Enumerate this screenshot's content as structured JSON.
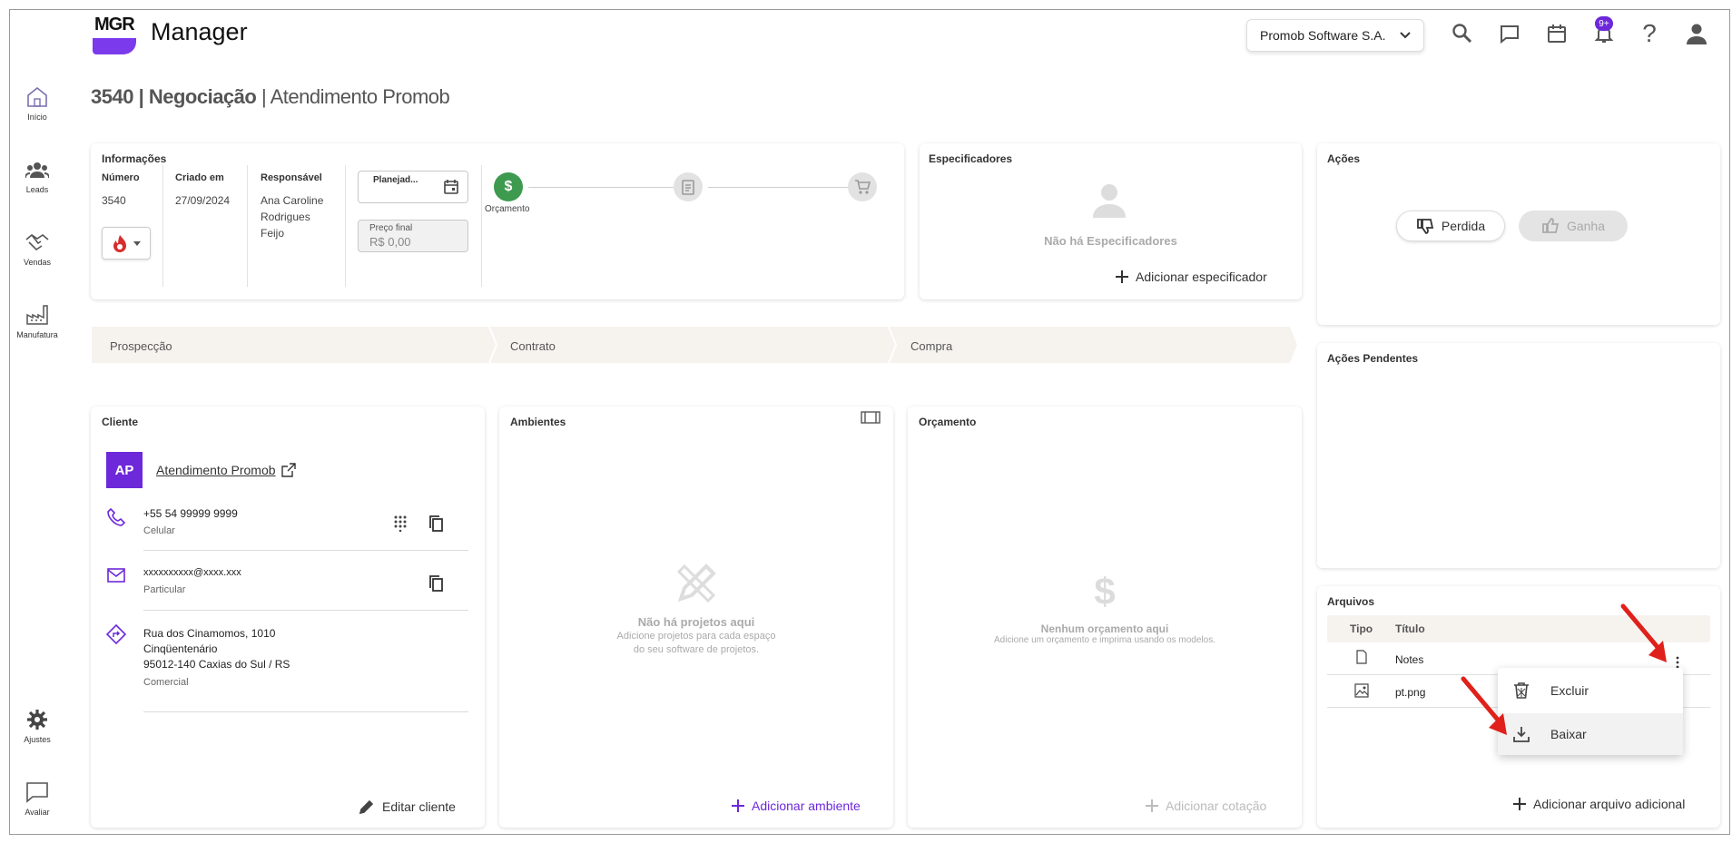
{
  "app": {
    "logo_text": "MGR",
    "title": "Manager",
    "company": "Promob Software S.A.",
    "notif_badge": "9+"
  },
  "sidebar": {
    "items": [
      {
        "label": "Início",
        "icon": "home-icon"
      },
      {
        "label": "Leads",
        "icon": "people-icon"
      },
      {
        "label": "Vendas",
        "icon": "handshake-icon"
      },
      {
        "label": "Manufatura",
        "icon": "factory-icon"
      }
    ],
    "bottom": [
      {
        "label": "Ajustes",
        "icon": "gear-icon"
      },
      {
        "label": "Avaliar",
        "icon": "chat-icon"
      }
    ]
  },
  "page": {
    "number": "3540",
    "type": "Negociação",
    "name": "Atendimento Promob"
  },
  "info": {
    "title": "Informações",
    "numero_label": "Número",
    "numero": "3540",
    "criado_label": "Criado em",
    "criado": "27/09/2024",
    "resp_label": "Responsável",
    "resp_lines": [
      "Ana Caroline",
      "Rodrigues",
      "Feijo"
    ],
    "planejado_label": "Planejad...",
    "preco_label": "Preço final",
    "preco": "R$ 0,00",
    "step1": "Orçamento"
  },
  "specs": {
    "title": "Especificadores",
    "empty": "Não há Especificadores",
    "add": "Adicionar especificador"
  },
  "actions": {
    "title": "Ações",
    "lose": "Perdida",
    "win": "Ganha"
  },
  "pending": {
    "title": "Ações Pendentes"
  },
  "pipeline": [
    "Prospecção",
    "Contrato",
    "Compra"
  ],
  "client": {
    "title": "Cliente",
    "initials": "AP",
    "name": "Atendimento Promob",
    "phone": "+55 54 99999 9999",
    "phone_type": "Celular",
    "email": "xxxxxxxxxx@xxxx.xxx",
    "email_type": "Particular",
    "addr1": "Rua dos Cinamomos, 1010",
    "addr2": "Cinqüentenário",
    "addr3": "95012-140 Caxias do Sul / RS",
    "addr_type": "Comercial",
    "edit": "Editar cliente"
  },
  "ambientes": {
    "title": "Ambientes",
    "empty": "Não há projetos aqui",
    "sub1": "Adicione projetos para cada espaço",
    "sub2": "do seu software de projetos.",
    "add": "Adicionar ambiente"
  },
  "orcamento": {
    "title": "Orçamento",
    "empty": "Nenhum orçamento aqui",
    "sub": "Adicione um orçamento e imprima usando os modelos.",
    "add": "Adicionar cotação"
  },
  "files": {
    "title": "Arquivos",
    "col_tipo": "Tipo",
    "col_titulo": "Título",
    "rows": [
      {
        "name": "Notes",
        "icon": "file-icon"
      },
      {
        "name": "pt.png",
        "icon": "image-icon"
      }
    ],
    "add": "Adicionar arquivo adicional"
  },
  "context_menu": {
    "delete": "Excluir",
    "download": "Baixar"
  },
  "colors": {
    "accent": "#6d28d9",
    "green": "#3d9a4f",
    "annotation": "#e0201b"
  }
}
